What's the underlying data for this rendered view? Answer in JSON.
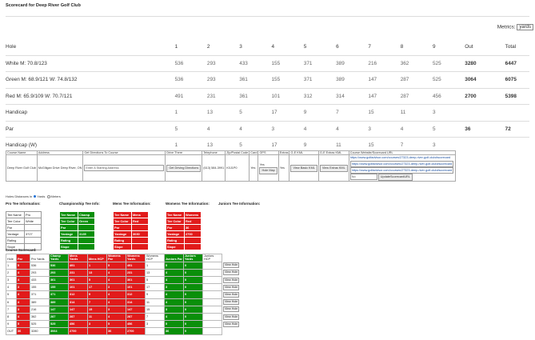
{
  "page": {
    "title": "Scorecard for Deep River Golf Club"
  },
  "metrics": {
    "label": "Metrics:",
    "selected": "yards"
  },
  "scorecard": {
    "header": [
      "Hole",
      "1",
      "2",
      "3",
      "4",
      "5",
      "6",
      "7",
      "8",
      "9",
      "Out",
      "Total"
    ],
    "rows": [
      {
        "label": "White M: 70.8/123",
        "values": [
          "536",
          "293",
          "433",
          "155",
          "371",
          "389",
          "216",
          "362",
          "525"
        ],
        "out": "3280",
        "total": "6447"
      },
      {
        "label": "Green M: 68.9/121 W: 74.8/132",
        "values": [
          "536",
          "293",
          "361",
          "155",
          "371",
          "389",
          "147",
          "287",
          "525"
        ],
        "out": "3064",
        "total": "6075"
      },
      {
        "label": "Red M: 65.9/109 W: 70.7/121",
        "values": [
          "491",
          "231",
          "361",
          "101",
          "312",
          "314",
          "147",
          "287",
          "456"
        ],
        "out": "2700",
        "total": "5398"
      },
      {
        "label": "Handicap",
        "values": [
          "1",
          "13",
          "5",
          "17",
          "9",
          "7",
          "15",
          "11",
          "3"
        ],
        "out": "",
        "total": ""
      },
      {
        "label": "Par",
        "values": [
          "5",
          "4",
          "4",
          "3",
          "4",
          "4",
          "3",
          "4",
          "5"
        ],
        "out": "36",
        "total": "72"
      },
      {
        "label": "Handicap (W)",
        "values": [
          "1",
          "13",
          "5",
          "17",
          "9",
          "11",
          "15",
          "7",
          "3"
        ],
        "out": "",
        "total": ""
      }
    ]
  },
  "course_info": {
    "headers": [
      "Course Name",
      "Address",
      "Get Directions To Course",
      "Drive There",
      "Telephone",
      "Zip/Postal Code",
      "Card",
      "GPS",
      "Extras",
      "G-E KML",
      "G-E Extras KML",
      "Course Website/Scorecard URL"
    ],
    "course_name": "Deep River Golf Club",
    "address": "McGlligan Drive Deep River, ON",
    "directions_placeholder": "Enter A Starting Address",
    "drive_button": "Get Driving Directions",
    "telephone": "(613) 584-3991",
    "zip": "K0J1P0",
    "card": "Yes",
    "gps_yes": "Yes",
    "gps_button": "Hole Map",
    "extras": "Yes",
    "kml_button": "View Basic KML",
    "extras_kml_button": "View Extras KML",
    "urls": [
      "https://www.golfadvisor.com/courses/27323-deep-river-golf-club#scorecard",
      "https://www.golfadvisor.com/courses/27323-deep-river-golf-club#scorecard",
      "https://www.golfadvisor.com/courses/27323-deep-river-golf-club#scorecard"
    ],
    "no_value": "No",
    "update_button": "UpdateScorecardURL"
  },
  "holes_distances": {
    "label": "Holes Distances in",
    "yards": "Yards",
    "meters": "Meters"
  },
  "tee_info": {
    "headers": [
      "Pro Tee Information:",
      "Championship Tee Info:",
      "Mens Tee Information:",
      "Womens Tee Information:",
      "Juniors Tee Information:"
    ],
    "pro": [
      [
        "Tee Name",
        "Pro"
      ],
      [
        "Tee Color",
        "White"
      ],
      [
        "Par",
        ""
      ],
      [
        "Yardage",
        "3727"
      ],
      [
        "Rating",
        ""
      ],
      [
        "Slope",
        ""
      ]
    ],
    "champ": [
      [
        "Tee Name",
        "Champ"
      ],
      [
        "Tee Color",
        "Green"
      ],
      [
        "Par",
        ""
      ],
      [
        "Yardage",
        "3135"
      ],
      [
        "Rating",
        ""
      ],
      [
        "Slope",
        ""
      ]
    ],
    "mens": [
      [
        "Tee Name",
        "Mens"
      ],
      [
        "Tee Color",
        "Red"
      ],
      [
        "Par",
        ""
      ],
      [
        "Yardage",
        "3030"
      ],
      [
        "Rating",
        ""
      ],
      [
        "Slope",
        ""
      ]
    ],
    "womens": [
      [
        "Tee Name",
        "Womens"
      ],
      [
        "Tee Color",
        "Red"
      ],
      [
        "Par",
        "36"
      ],
      [
        "Yardage",
        "2700"
      ],
      [
        "Rating",
        ""
      ],
      [
        "Slope",
        ""
      ]
    ]
  },
  "course_scorecard": {
    "title": "Course Scorecard:",
    "header": [
      "Hole",
      "Par",
      "Pro Yards",
      "Champ Yards",
      "Mens Yards",
      "Mens HCP",
      "Womens Par",
      "Womens Yards",
      "Womens HCP",
      "Juniors Par",
      "Juniors Yards",
      "Juniors HCP",
      ""
    ],
    "view_label": "View Hole",
    "rows": [
      [
        "1",
        "5",
        "536",
        "536",
        "491",
        "1",
        "5",
        "491",
        "1",
        "5",
        "0",
        ""
      ],
      [
        "2",
        "4",
        "293",
        "293",
        "231",
        "13",
        "4",
        "231",
        "13",
        "4",
        "0",
        ""
      ],
      [
        "3",
        "4",
        "433",
        "361",
        "361",
        "5",
        "4",
        "361",
        "5",
        "4",
        "0",
        ""
      ],
      [
        "4",
        "3",
        "155",
        "155",
        "101",
        "17",
        "3",
        "101",
        "17",
        "3",
        "0",
        ""
      ],
      [
        "5",
        "4",
        "371",
        "371",
        "312",
        "9",
        "4",
        "312",
        "9",
        "4",
        "0",
        ""
      ],
      [
        "6",
        "4",
        "389",
        "389",
        "314",
        "7",
        "4",
        "314",
        "11",
        "4",
        "0",
        ""
      ],
      [
        "7",
        "3",
        "216",
        "147",
        "147",
        "15",
        "3",
        "147",
        "15",
        "3",
        "0",
        ""
      ],
      [
        "8",
        "4",
        "362",
        "287",
        "287",
        "11",
        "4",
        "287",
        "7",
        "4",
        "0",
        ""
      ],
      [
        "9",
        "5",
        "525",
        "525",
        "456",
        "3",
        "5",
        "456",
        "3",
        "5",
        "0",
        ""
      ]
    ],
    "out": [
      "OUT",
      "36",
      "3280",
      "3064",
      "2700",
      "",
      "36",
      "2700",
      "",
      "36",
      "0",
      ""
    ]
  }
}
